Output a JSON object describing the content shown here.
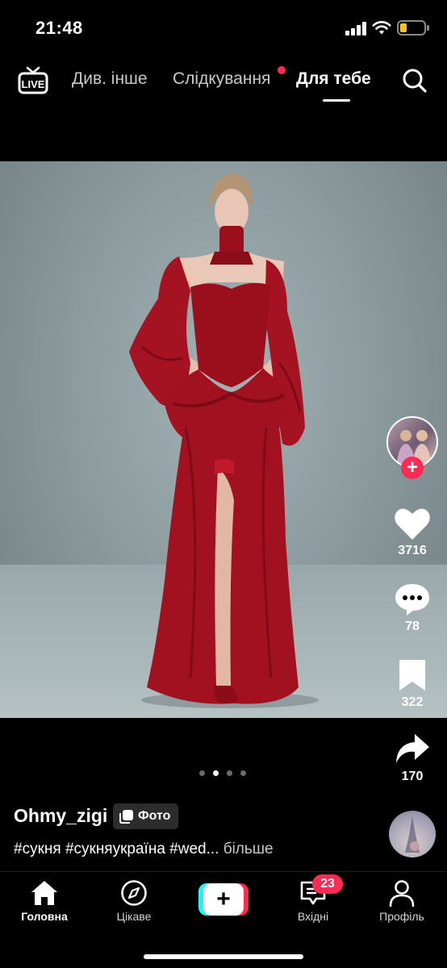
{
  "status_bar": {
    "time": "21:48",
    "battery_color": "#f5c518"
  },
  "top_nav": {
    "live_label": "LIVE",
    "tabs": [
      {
        "label": "Див. інше"
      },
      {
        "label": "Слідкування"
      },
      {
        "label": "Для тебе"
      }
    ],
    "active_tab": "Для тебе",
    "notification_dot_color": "#fe2c55"
  },
  "post": {
    "carousel": {
      "count": 4,
      "active": 2
    },
    "actions": {
      "likes": "3716",
      "comments": "78",
      "saves": "322",
      "shares": "170"
    },
    "author": {
      "username": "Ohmy_zigi",
      "badge_label": "Фото"
    },
    "caption": {
      "text": "#сукня #сукняукраїна #wed...",
      "more_label": "більше"
    }
  },
  "bottom_nav": {
    "items": [
      {
        "label": "Головна"
      },
      {
        "label": "Цікаве"
      },
      {
        "label": "Вхідні",
        "badge": "23"
      },
      {
        "label": "Профіль"
      }
    ]
  },
  "colors": {
    "accent": "#fe2c55",
    "accent_secondary": "#25f4ee",
    "dress": "#9b0f1c"
  }
}
